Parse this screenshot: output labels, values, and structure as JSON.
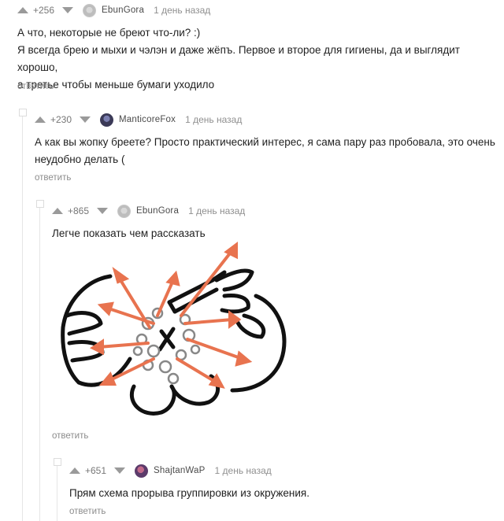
{
  "comments": [
    {
      "rating": "+256",
      "nick": "EbunGora",
      "time": "1 день назад",
      "lines": [
        "А что, некоторые не бреют что-ли? :)",
        "Я всегда брею и мыхи и чэлэн и даже жёпъ. Первое и второе для гигиены, да и выглядит хорошо,",
        "а третье чтобы меньше бумаги уходило"
      ],
      "reply": "ответить"
    },
    {
      "rating": "+230",
      "nick": "ManticoreFox",
      "time": "1 день назад",
      "lines": [
        "А как вы жопку бреете? Просто практический интерес, я сама пару раз пробовала, это очень",
        "неудобно делать ("
      ],
      "reply": "ответить"
    },
    {
      "rating": "+865",
      "nick": "EbunGora",
      "time": "1 день назад",
      "lines": [
        "Легче показать чем рассказать"
      ],
      "reply": "ответить"
    },
    {
      "rating": "+651",
      "nick": "ShajtanWaP",
      "time": "1 день назад",
      "lines": [
        "Прям схема прорыва группировки из окружения."
      ],
      "reply": "ответить"
    }
  ],
  "icons": {
    "upvote": "triangle-up-icon",
    "downvote": "triangle-down-icon"
  },
  "colors": {
    "drawing_stroke": "#111111",
    "drawing_arrows": "#e8734f",
    "meta_text": "#8b8b8b"
  }
}
